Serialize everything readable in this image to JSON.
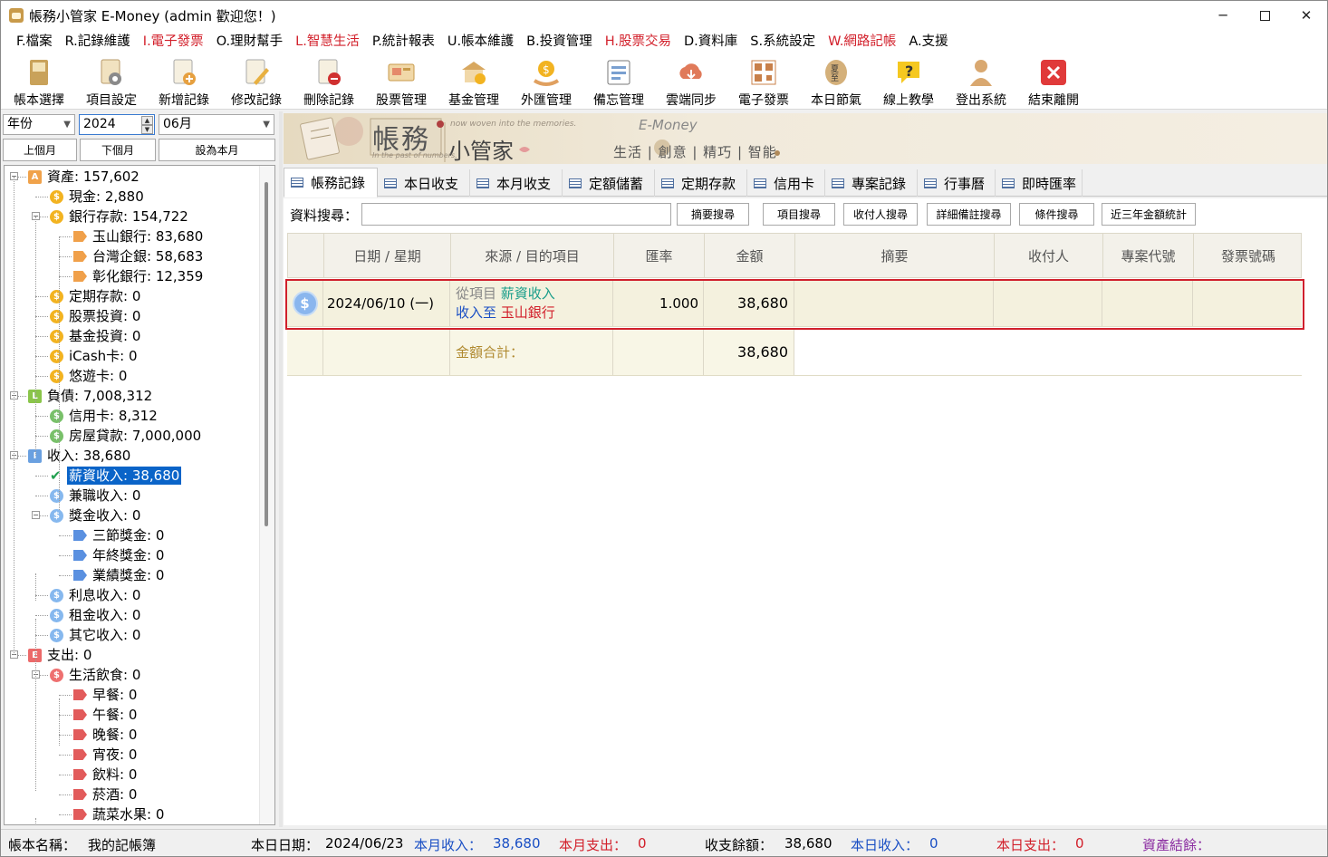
{
  "window": {
    "title": "帳務小管家 E-Money (admin 歡迎您！)"
  },
  "menu": [
    {
      "label": "F.檔案",
      "red": false
    },
    {
      "label": "R.記錄維護",
      "red": false
    },
    {
      "label": "I.電子發票",
      "red": true
    },
    {
      "label": "O.理財幫手",
      "red": false
    },
    {
      "label": "L.智慧生活",
      "red": true
    },
    {
      "label": "P.統計報表",
      "red": false
    },
    {
      "label": "U.帳本維護",
      "red": false
    },
    {
      "label": "B.投資管理",
      "red": false
    },
    {
      "label": "H.股票交易",
      "red": true
    },
    {
      "label": "D.資料庫",
      "red": false
    },
    {
      "label": "S.系統設定",
      "red": false
    },
    {
      "label": "W.網路記帳",
      "red": true
    },
    {
      "label": "A.支援",
      "red": false
    }
  ],
  "toolbar": [
    {
      "label": "帳本選擇",
      "icon": "ledger-book-icon"
    },
    {
      "label": "項目設定",
      "icon": "gear-settings-icon"
    },
    {
      "label": "新增記錄",
      "icon": "add-record-icon"
    },
    {
      "label": "修改記錄",
      "icon": "edit-record-icon"
    },
    {
      "label": "刪除記錄",
      "icon": "delete-record-icon"
    },
    {
      "label": "股票管理",
      "icon": "stock-icon"
    },
    {
      "label": "基金管理",
      "icon": "fund-icon"
    },
    {
      "label": "外匯管理",
      "icon": "forex-icon"
    },
    {
      "label": "備忘管理",
      "icon": "memo-icon"
    },
    {
      "label": "雲端同步",
      "icon": "cloud-sync-icon"
    },
    {
      "label": "電子發票",
      "icon": "qr-invoice-icon"
    },
    {
      "label": "本日節氣",
      "icon": "solar-term-icon"
    },
    {
      "label": "線上教學",
      "icon": "help-icon"
    },
    {
      "label": "登出系統",
      "icon": "logout-user-icon"
    },
    {
      "label": "結束離開",
      "icon": "exit-icon"
    }
  ],
  "left": {
    "period_type": "年份",
    "year": "2024",
    "month": "06月",
    "prev_month": "上個月",
    "next_month": "下個月",
    "set_this_month": "設為本月"
  },
  "tree": [
    {
      "label": "資產: 157,602",
      "icon": "A",
      "kind": "badge-A",
      "level": 0,
      "exp": "-"
    },
    {
      "label": "現金: 2,880",
      "kind": "coin-gold",
      "level": 1
    },
    {
      "label": "銀行存款: 154,722",
      "kind": "coin-gold",
      "level": 1,
      "exp": "-"
    },
    {
      "label": "玉山銀行: 83,680",
      "kind": "tag-orange",
      "level": 2
    },
    {
      "label": "台灣企銀: 58,683",
      "kind": "tag-orange",
      "level": 2
    },
    {
      "label": "彰化銀行: 12,359",
      "kind": "tag-orange",
      "level": 2
    },
    {
      "label": "定期存款: 0",
      "kind": "coin-gold",
      "level": 1
    },
    {
      "label": "股票投資: 0",
      "kind": "coin-gold",
      "level": 1
    },
    {
      "label": "基金投資: 0",
      "kind": "coin-gold",
      "level": 1
    },
    {
      "label": "iCash卡: 0",
      "kind": "coin-gold",
      "level": 1
    },
    {
      "label": "悠遊卡: 0",
      "kind": "coin-gold",
      "level": 1
    },
    {
      "label": "負債: 7,008,312",
      "icon": "L",
      "kind": "badge-L",
      "level": 0,
      "exp": "-"
    },
    {
      "label": "信用卡: 8,312",
      "kind": "coin-green",
      "level": 1
    },
    {
      "label": "房屋貸款: 7,000,000",
      "kind": "coin-green",
      "level": 1
    },
    {
      "label": "收入: 38,680",
      "icon": "I",
      "kind": "badge-I",
      "level": 0,
      "exp": "-"
    },
    {
      "label": "薪資收入: 38,680",
      "kind": "check",
      "level": 1,
      "selected": true
    },
    {
      "label": "兼職收入: 0",
      "kind": "coin-blue",
      "level": 1
    },
    {
      "label": "獎金收入: 0",
      "kind": "coin-blue",
      "level": 1,
      "exp": "-"
    },
    {
      "label": "三節獎金: 0",
      "kind": "tag-blue",
      "level": 2
    },
    {
      "label": "年終獎金: 0",
      "kind": "tag-blue",
      "level": 2
    },
    {
      "label": "業績獎金: 0",
      "kind": "tag-blue",
      "level": 2
    },
    {
      "label": "利息收入: 0",
      "kind": "coin-blue",
      "level": 1
    },
    {
      "label": "租金收入: 0",
      "kind": "coin-blue",
      "level": 1
    },
    {
      "label": "其它收入: 0",
      "kind": "coin-blue",
      "level": 1
    },
    {
      "label": "支出: 0",
      "icon": "E",
      "kind": "badge-E",
      "level": 0,
      "exp": "-"
    },
    {
      "label": "生活飲食: 0",
      "kind": "coin-red",
      "level": 1,
      "exp": "-"
    },
    {
      "label": "早餐: 0",
      "kind": "tag-red",
      "level": 2
    },
    {
      "label": "午餐: 0",
      "kind": "tag-red",
      "level": 2
    },
    {
      "label": "晚餐: 0",
      "kind": "tag-red",
      "level": 2
    },
    {
      "label": "宵夜: 0",
      "kind": "tag-red",
      "level": 2
    },
    {
      "label": "飲料: 0",
      "kind": "tag-red",
      "level": 2
    },
    {
      "label": "菸酒: 0",
      "kind": "tag-red",
      "level": 2
    },
    {
      "label": "蔬菜水果: 0",
      "kind": "tag-red",
      "level": 2
    }
  ],
  "banner": {
    "title1": "帳務",
    "title2": "小管家",
    "brand": "E-Money",
    "tag_top": "now woven into the memories.",
    "tag_bottom": "In the past of numbers.",
    "slogan": "生活 | 創意 | 精巧 | 智能"
  },
  "tabs": [
    {
      "label": "帳務記錄",
      "active": true
    },
    {
      "label": "本日收支"
    },
    {
      "label": "本月收支"
    },
    {
      "label": "定額儲蓄"
    },
    {
      "label": "定期存款"
    },
    {
      "label": "信用卡"
    },
    {
      "label": "專案記錄"
    },
    {
      "label": "行事曆"
    },
    {
      "label": "即時匯率"
    }
  ],
  "search": {
    "label": "資料搜尋：",
    "value": "",
    "buttons": [
      "摘要搜尋",
      "項目搜尋",
      "收付人搜尋",
      "詳細備註搜尋",
      "條件搜尋",
      "近三年金額統計"
    ]
  },
  "grid": {
    "columns": [
      "",
      "日期 / 星期",
      "來源 / 目的項目",
      "匯率",
      "金額",
      "摘要",
      "收付人",
      "專案代號",
      "發票號碼"
    ],
    "rows": [
      {
        "date": "2024/06/10 (一)",
        "from_label": "從項目",
        "from_value": "薪資收入",
        "to_label": "收入至",
        "to_value": "玉山銀行",
        "rate": "1.000",
        "amount": "38,680",
        "summary": "",
        "payee": "",
        "project": "",
        "invoice": ""
      }
    ],
    "total_label": "金額合計：",
    "total_amount": "38,680"
  },
  "status": {
    "book_label": "帳本名稱：",
    "book_value": "我的記帳簿",
    "today_label": "本日日期：",
    "today_value": "2024/06/23",
    "month_income_label": "本月收入：",
    "month_income_value": "38,680",
    "month_expense_label": "本月支出：",
    "month_expense_value": "0",
    "balance_label": "收支餘額：",
    "balance_value": "38,680",
    "day_income_label": "本日收入：",
    "day_income_value": "0",
    "day_expense_label": "本日支出：",
    "day_expense_value": "0",
    "asset_label": "資產結餘："
  }
}
